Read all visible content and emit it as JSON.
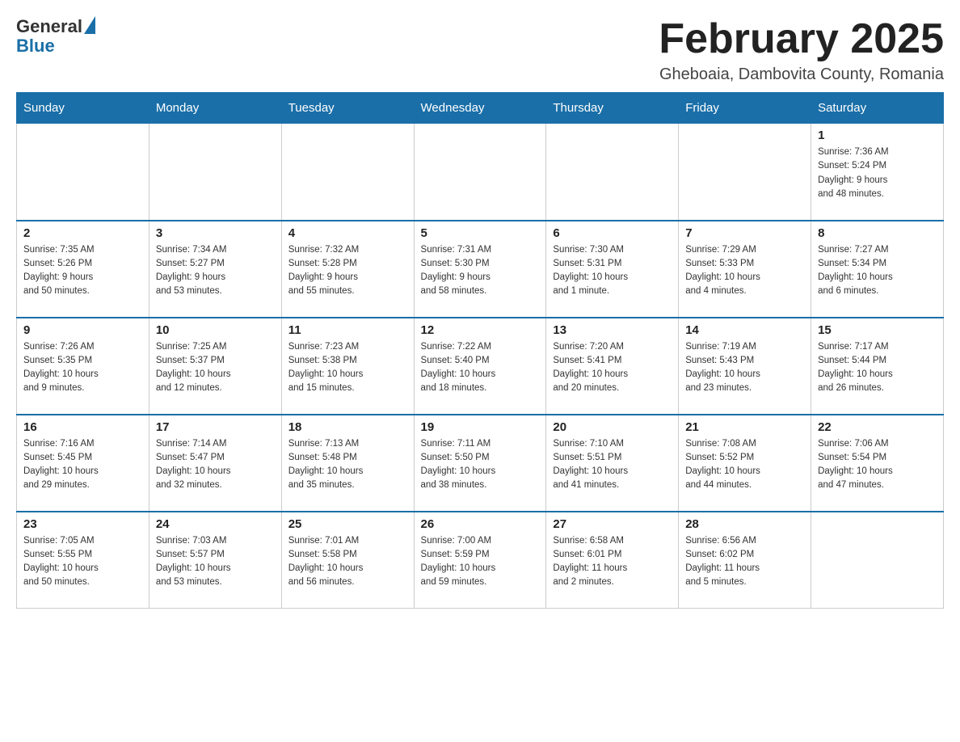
{
  "header": {
    "logo_general": "General",
    "logo_blue": "Blue",
    "month_title": "February 2025",
    "location": "Gheboaia, Dambovita County, Romania"
  },
  "weekdays": [
    "Sunday",
    "Monday",
    "Tuesday",
    "Wednesday",
    "Thursday",
    "Friday",
    "Saturday"
  ],
  "weeks": [
    [
      {
        "day": "",
        "info": ""
      },
      {
        "day": "",
        "info": ""
      },
      {
        "day": "",
        "info": ""
      },
      {
        "day": "",
        "info": ""
      },
      {
        "day": "",
        "info": ""
      },
      {
        "day": "",
        "info": ""
      },
      {
        "day": "1",
        "info": "Sunrise: 7:36 AM\nSunset: 5:24 PM\nDaylight: 9 hours\nand 48 minutes."
      }
    ],
    [
      {
        "day": "2",
        "info": "Sunrise: 7:35 AM\nSunset: 5:26 PM\nDaylight: 9 hours\nand 50 minutes."
      },
      {
        "day": "3",
        "info": "Sunrise: 7:34 AM\nSunset: 5:27 PM\nDaylight: 9 hours\nand 53 minutes."
      },
      {
        "day": "4",
        "info": "Sunrise: 7:32 AM\nSunset: 5:28 PM\nDaylight: 9 hours\nand 55 minutes."
      },
      {
        "day": "5",
        "info": "Sunrise: 7:31 AM\nSunset: 5:30 PM\nDaylight: 9 hours\nand 58 minutes."
      },
      {
        "day": "6",
        "info": "Sunrise: 7:30 AM\nSunset: 5:31 PM\nDaylight: 10 hours\nand 1 minute."
      },
      {
        "day": "7",
        "info": "Sunrise: 7:29 AM\nSunset: 5:33 PM\nDaylight: 10 hours\nand 4 minutes."
      },
      {
        "day": "8",
        "info": "Sunrise: 7:27 AM\nSunset: 5:34 PM\nDaylight: 10 hours\nand 6 minutes."
      }
    ],
    [
      {
        "day": "9",
        "info": "Sunrise: 7:26 AM\nSunset: 5:35 PM\nDaylight: 10 hours\nand 9 minutes."
      },
      {
        "day": "10",
        "info": "Sunrise: 7:25 AM\nSunset: 5:37 PM\nDaylight: 10 hours\nand 12 minutes."
      },
      {
        "day": "11",
        "info": "Sunrise: 7:23 AM\nSunset: 5:38 PM\nDaylight: 10 hours\nand 15 minutes."
      },
      {
        "day": "12",
        "info": "Sunrise: 7:22 AM\nSunset: 5:40 PM\nDaylight: 10 hours\nand 18 minutes."
      },
      {
        "day": "13",
        "info": "Sunrise: 7:20 AM\nSunset: 5:41 PM\nDaylight: 10 hours\nand 20 minutes."
      },
      {
        "day": "14",
        "info": "Sunrise: 7:19 AM\nSunset: 5:43 PM\nDaylight: 10 hours\nand 23 minutes."
      },
      {
        "day": "15",
        "info": "Sunrise: 7:17 AM\nSunset: 5:44 PM\nDaylight: 10 hours\nand 26 minutes."
      }
    ],
    [
      {
        "day": "16",
        "info": "Sunrise: 7:16 AM\nSunset: 5:45 PM\nDaylight: 10 hours\nand 29 minutes."
      },
      {
        "day": "17",
        "info": "Sunrise: 7:14 AM\nSunset: 5:47 PM\nDaylight: 10 hours\nand 32 minutes."
      },
      {
        "day": "18",
        "info": "Sunrise: 7:13 AM\nSunset: 5:48 PM\nDaylight: 10 hours\nand 35 minutes."
      },
      {
        "day": "19",
        "info": "Sunrise: 7:11 AM\nSunset: 5:50 PM\nDaylight: 10 hours\nand 38 minutes."
      },
      {
        "day": "20",
        "info": "Sunrise: 7:10 AM\nSunset: 5:51 PM\nDaylight: 10 hours\nand 41 minutes."
      },
      {
        "day": "21",
        "info": "Sunrise: 7:08 AM\nSunset: 5:52 PM\nDaylight: 10 hours\nand 44 minutes."
      },
      {
        "day": "22",
        "info": "Sunrise: 7:06 AM\nSunset: 5:54 PM\nDaylight: 10 hours\nand 47 minutes."
      }
    ],
    [
      {
        "day": "23",
        "info": "Sunrise: 7:05 AM\nSunset: 5:55 PM\nDaylight: 10 hours\nand 50 minutes."
      },
      {
        "day": "24",
        "info": "Sunrise: 7:03 AM\nSunset: 5:57 PM\nDaylight: 10 hours\nand 53 minutes."
      },
      {
        "day": "25",
        "info": "Sunrise: 7:01 AM\nSunset: 5:58 PM\nDaylight: 10 hours\nand 56 minutes."
      },
      {
        "day": "26",
        "info": "Sunrise: 7:00 AM\nSunset: 5:59 PM\nDaylight: 10 hours\nand 59 minutes."
      },
      {
        "day": "27",
        "info": "Sunrise: 6:58 AM\nSunset: 6:01 PM\nDaylight: 11 hours\nand 2 minutes."
      },
      {
        "day": "28",
        "info": "Sunrise: 6:56 AM\nSunset: 6:02 PM\nDaylight: 11 hours\nand 5 minutes."
      },
      {
        "day": "",
        "info": ""
      }
    ]
  ]
}
